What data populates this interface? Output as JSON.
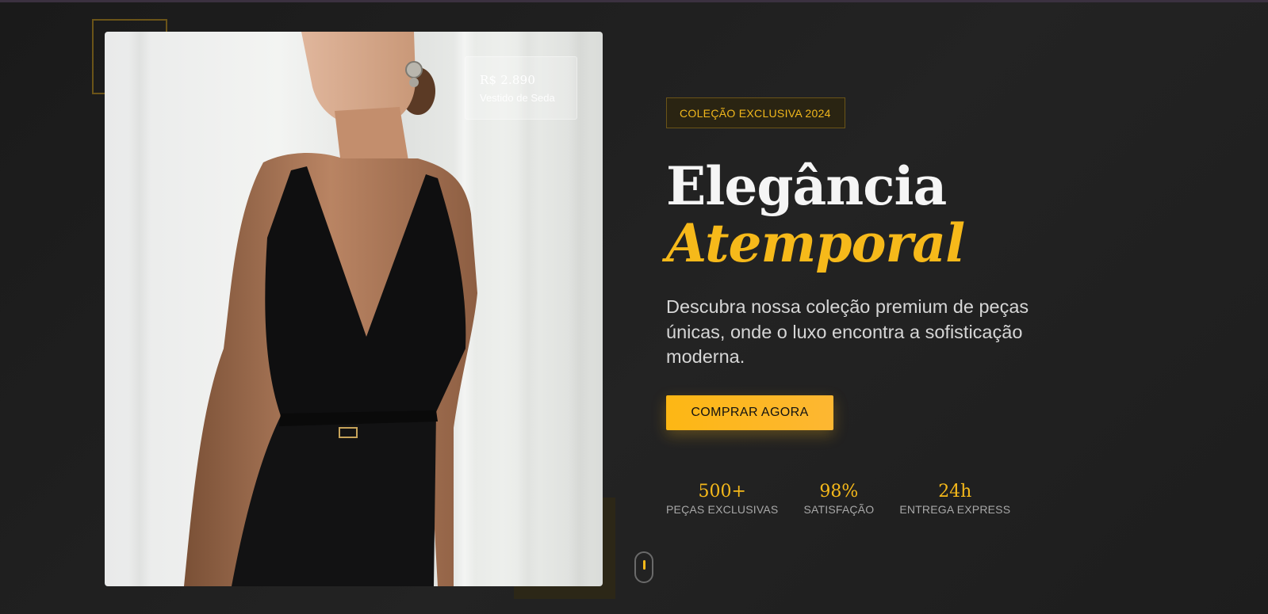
{
  "hero": {
    "badge": "COLEÇÃO EXCLUSIVA 2024",
    "title_line1": "Elegância",
    "title_line2": "Atemporal",
    "description": "Descubra nossa coleção premium de peças únicas, onde o luxo encontra a sofisticação moderna.",
    "cta_label": "COMPRAR AGORA"
  },
  "price_card": {
    "value": "R$ 2.890",
    "label": "Vestido de Seda"
  },
  "stats": [
    {
      "value": "500+",
      "label": "PEÇAS EXCLUSIVAS"
    },
    {
      "value": "98%",
      "label": "SATISFAÇÃO"
    },
    {
      "value": "24h",
      "label": "ENTREGA EXPRESS"
    }
  ],
  "icons": {
    "scroll_indicator": "mouse-scroll-icon"
  },
  "colors": {
    "accent": "#f6b91a",
    "background": "#1c1c1d",
    "text": "#f5f5f5",
    "muted": "#a8a8a8"
  }
}
